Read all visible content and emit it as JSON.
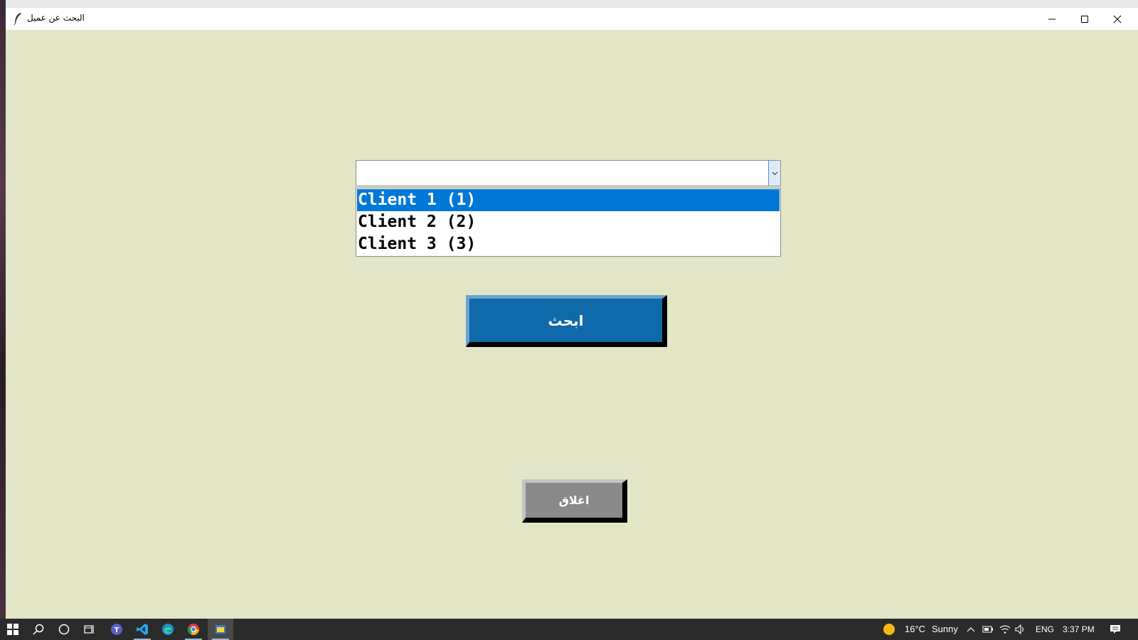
{
  "window": {
    "title": "البحث عن عميل"
  },
  "combo": {
    "value": ""
  },
  "listbox": {
    "items": [
      {
        "label": "Client 1 (1)",
        "selected": true
      },
      {
        "label": "Client 2 (2)",
        "selected": false
      },
      {
        "label": "Client 3 (3)",
        "selected": false
      }
    ]
  },
  "buttons": {
    "search_label": "ابحث",
    "close_label": "اغلاق"
  },
  "taskbar": {
    "weather_temp": "16°C",
    "weather_text": "Sunny",
    "language": "ENG",
    "time": "3:37 PM"
  },
  "colors": {
    "window_bg": "#e3e6c6",
    "selection": "#0078d7",
    "search_button": "#0e6aa8",
    "close_button": "#8a8a8a"
  }
}
